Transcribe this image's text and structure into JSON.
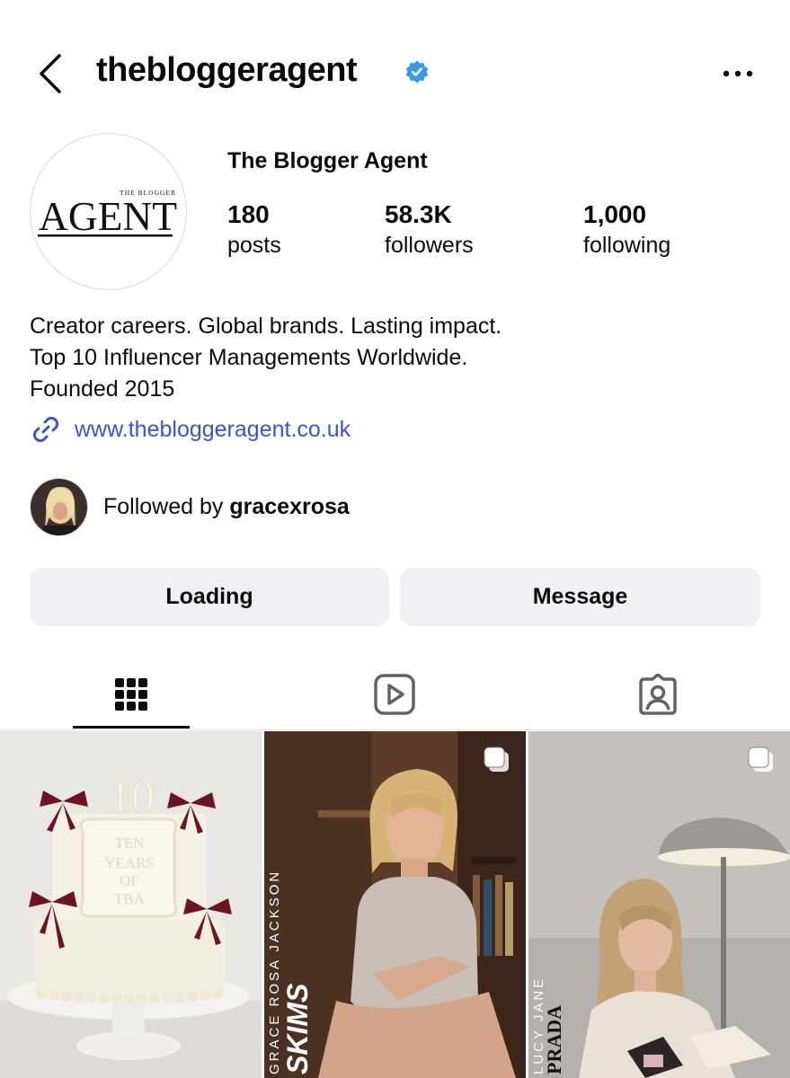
{
  "header": {
    "username": "thebloggeragent",
    "back_icon": "chevron-left-icon",
    "verified_icon": "verified-badge-icon",
    "more_icon": "more-horizontal-icon"
  },
  "profile": {
    "display_name": "The Blogger Agent",
    "avatar_logo_small": "THE BLOGGER",
    "avatar_logo_large": "AGENT",
    "stats": [
      {
        "value": "180",
        "label": "posts"
      },
      {
        "value": "58.3K",
        "label": "followers"
      },
      {
        "value": "1,000",
        "label": "following"
      }
    ],
    "bio_lines": [
      "Creator careers. Global brands. Lasting impact.",
      "Top 10 Influencer Managements Worldwide.",
      "Founded 2015"
    ],
    "link_icon": "link-icon",
    "link": "www.thebloggeragent.co.uk",
    "followed_by_prefix": "Followed by ",
    "followed_by_user": "gracexrosa"
  },
  "actions": {
    "primary": "Loading",
    "secondary": "Message"
  },
  "tabs": [
    {
      "icon": "grid-icon",
      "active": true
    },
    {
      "icon": "reels-icon",
      "active": false
    },
    {
      "icon": "tagged-icon",
      "active": false
    }
  ],
  "posts": [
    {
      "cake_number": "10",
      "cake_lines": [
        "TEN",
        "YEARS",
        "OF",
        "TBA"
      ],
      "multi": false
    },
    {
      "name_label": "GRACE ROSA JACKSON",
      "brand_label": "SKIMS",
      "multi": true
    },
    {
      "name_label": "LUCY JANE",
      "brand_label": "PRADA",
      "multi": true
    }
  ],
  "colors": {
    "link": "#3f50d9",
    "verified": "#3897f0",
    "button_bg": "#eff1f4",
    "text": "#0b0b0b"
  }
}
